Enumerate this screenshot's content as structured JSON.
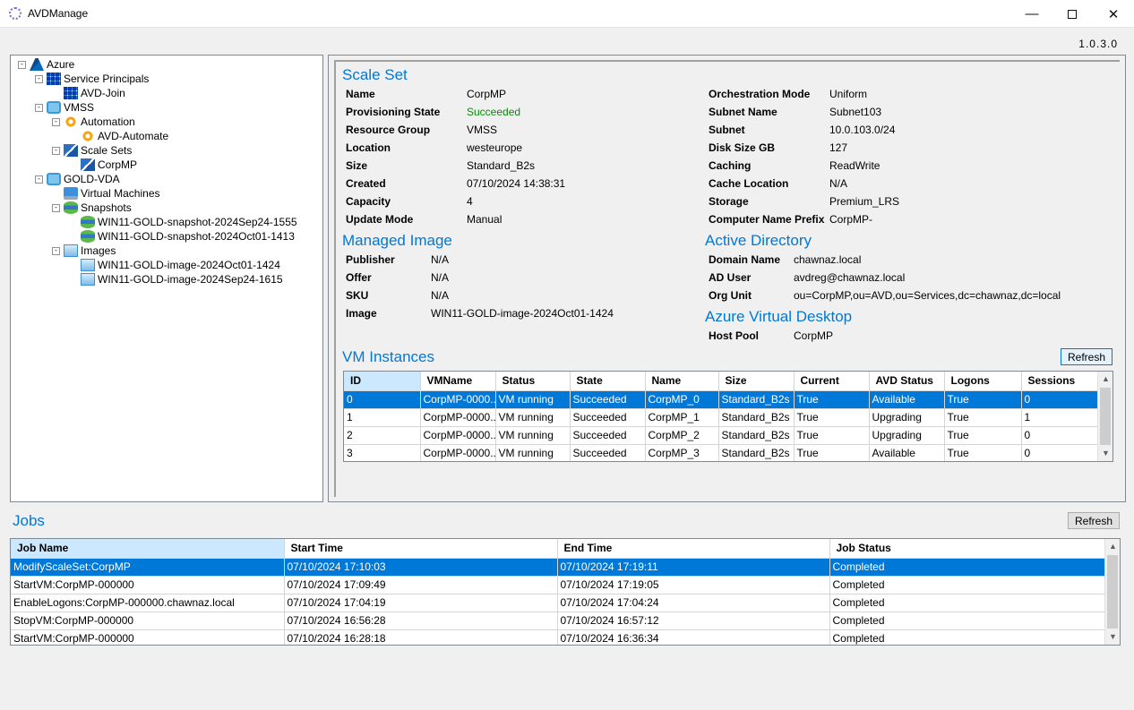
{
  "window": {
    "title": "AVDManage",
    "version": "1.0.3.0"
  },
  "tree": {
    "nodes": [
      {
        "label": "Azure",
        "icon": "azure-logo-icon"
      },
      {
        "label": "Service Principals",
        "icon": "service-principal-icon"
      },
      {
        "label": "AVD-Join",
        "icon": "service-principal-icon"
      },
      {
        "label": "VMSS",
        "icon": "resource-group-icon"
      },
      {
        "label": "Automation",
        "icon": "automation-gear-icon"
      },
      {
        "label": "AVD-Automate",
        "icon": "automation-gear-icon"
      },
      {
        "label": "Scale Sets",
        "icon": "scale-set-icon"
      },
      {
        "label": "CorpMP",
        "icon": "scale-set-icon"
      },
      {
        "label": "GOLD-VDA",
        "icon": "resource-group-icon"
      },
      {
        "label": "Virtual Machines",
        "icon": "virtual-machine-icon"
      },
      {
        "label": "Snapshots",
        "icon": "snapshot-icon"
      },
      {
        "label": "WIN11-GOLD-snapshot-2024Sep24-1555",
        "icon": "snapshot-icon"
      },
      {
        "label": "WIN11-GOLD-snapshot-2024Oct01-1413",
        "icon": "snapshot-icon"
      },
      {
        "label": "Images",
        "icon": "image-icon"
      },
      {
        "label": "WIN11-GOLD-image-2024Oct01-1424",
        "icon": "image-icon"
      },
      {
        "label": "WIN11-GOLD-image-2024Sep24-1615",
        "icon": "image-icon"
      }
    ]
  },
  "scale_set": {
    "title": "Scale Set",
    "left": [
      {
        "label": "Name",
        "value": "CorpMP"
      },
      {
        "label": "Provisioning State",
        "value": "Succeeded"
      },
      {
        "label": "Resource Group",
        "value": "VMSS"
      },
      {
        "label": "Location",
        "value": "westeurope"
      },
      {
        "label": "Size",
        "value": "Standard_B2s"
      },
      {
        "label": "Created",
        "value": "07/10/2024 14:38:31"
      },
      {
        "label": "Capacity",
        "value": "4"
      },
      {
        "label": "Update Mode",
        "value": "Manual"
      }
    ],
    "right": [
      {
        "label": "Orchestration Mode",
        "value": "Uniform"
      },
      {
        "label": "Subnet Name",
        "value": "Subnet103"
      },
      {
        "label": "Subnet",
        "value": "10.0.103.0/24"
      },
      {
        "label": "Disk Size GB",
        "value": "127"
      },
      {
        "label": "Caching",
        "value": "ReadWrite"
      },
      {
        "label": "Cache Location",
        "value": "N/A"
      },
      {
        "label": "Storage",
        "value": "Premium_LRS"
      },
      {
        "label": "Computer Name Prefix",
        "value": "CorpMP-"
      }
    ],
    "success_color": "#0a8a0a"
  },
  "managed_image": {
    "title": "Managed Image",
    "fields": [
      {
        "label": "Publisher",
        "value": "N/A"
      },
      {
        "label": "Offer",
        "value": "N/A"
      },
      {
        "label": "SKU",
        "value": "N/A"
      },
      {
        "label": "Image",
        "value": "WIN11-GOLD-image-2024Oct01-1424"
      }
    ]
  },
  "active_directory": {
    "title": "Active Directory",
    "fields": [
      {
        "label": "Domain Name",
        "value": "chawnaz.local"
      },
      {
        "label": "AD User",
        "value": "avdreg@chawnaz.local"
      },
      {
        "label": "Org Unit",
        "value": "ou=CorpMP,ou=AVD,ou=Services,dc=chawnaz,dc=local"
      }
    ]
  },
  "avd": {
    "title": "Azure Virtual Desktop",
    "fields": [
      {
        "label": "Host Pool",
        "value": "CorpMP"
      }
    ]
  },
  "vm_instances": {
    "title": "VM Instances",
    "refresh_label": "Refresh",
    "columns": [
      "ID",
      "VMName",
      "Status",
      "State",
      "Name",
      "Size",
      "Current",
      "AVD Status",
      "Logons",
      "Sessions"
    ],
    "rows": [
      [
        "0",
        "CorpMP-0000...",
        "VM running",
        "Succeeded",
        "CorpMP_0",
        "Standard_B2s",
        "True",
        "Available",
        "True",
        "0"
      ],
      [
        "1",
        "CorpMP-0000...",
        "VM running",
        "Succeeded",
        "CorpMP_1",
        "Standard_B2s",
        "True",
        "Upgrading",
        "True",
        "1"
      ],
      [
        "2",
        "CorpMP-0000...",
        "VM running",
        "Succeeded",
        "CorpMP_2",
        "Standard_B2s",
        "True",
        "Upgrading",
        "True",
        "0"
      ],
      [
        "3",
        "CorpMP-0000...",
        "VM running",
        "Succeeded",
        "CorpMP_3",
        "Standard_B2s",
        "True",
        "Available",
        "True",
        "0"
      ]
    ],
    "selected_row": 0
  },
  "jobs": {
    "title": "Jobs",
    "refresh_label": "Refresh",
    "columns": [
      "Job Name",
      "Start Time",
      "End Time",
      "Job Status"
    ],
    "rows": [
      [
        "ModifyScaleSet:CorpMP",
        "07/10/2024 17:10:03",
        "07/10/2024 17:19:11",
        "Completed"
      ],
      [
        "StartVM:CorpMP-000000",
        "07/10/2024 17:09:49",
        "07/10/2024 17:19:05",
        "Completed"
      ],
      [
        "EnableLogons:CorpMP-000000.chawnaz.local",
        "07/10/2024 17:04:19",
        "07/10/2024 17:04:24",
        "Completed"
      ],
      [
        "StopVM:CorpMP-000000",
        "07/10/2024 16:56:28",
        "07/10/2024 16:57:12",
        "Completed"
      ],
      [
        "StartVM:CorpMP-000000",
        "07/10/2024 16:28:18",
        "07/10/2024 16:36:34",
        "Completed"
      ]
    ],
    "selected_row": 0
  },
  "colors": {
    "accent": "#0078d7",
    "selection": "#0078d7",
    "header_selected": "#cce8ff"
  }
}
